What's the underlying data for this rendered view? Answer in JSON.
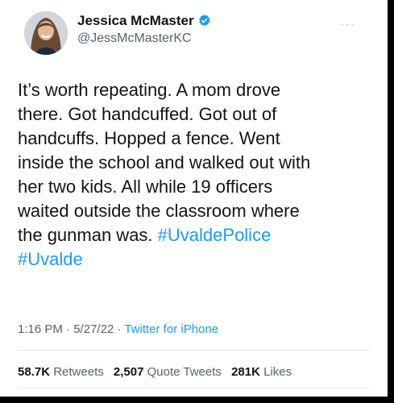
{
  "author": {
    "display_name": "Jessica McMaster",
    "handle": "@JessMcMasterKC",
    "verified": true,
    "avatar_icon": "profile-photo"
  },
  "menu_icon": "more-options-icon",
  "tweet": {
    "lines": [
      "It’s worth repeating. A mom drove",
      "there. Got handcuffed. Got out of",
      "handcuffs. Hopped a fence. Went",
      "inside the school and walked out with",
      "her two kids. All while 19 officers",
      "waited outside the classroom where",
      "the gunman was."
    ],
    "hashtags": [
      "#UvaldePolice",
      "#Uvalde"
    ]
  },
  "meta": {
    "time": "1:16 PM",
    "date": "5/27/22",
    "separator": "·",
    "source": "Twitter for iPhone"
  },
  "stats": {
    "retweets_count": "58.7K",
    "retweets_label": "Retweets",
    "quotes_count": "2,507",
    "quotes_label": "Quote Tweets",
    "likes_count": "281K",
    "likes_label": "Likes"
  },
  "colors": {
    "link": "#1d9bf0",
    "text": "#0f1419",
    "secondary": "#536471",
    "verified_badge": "#1d9bf0"
  }
}
